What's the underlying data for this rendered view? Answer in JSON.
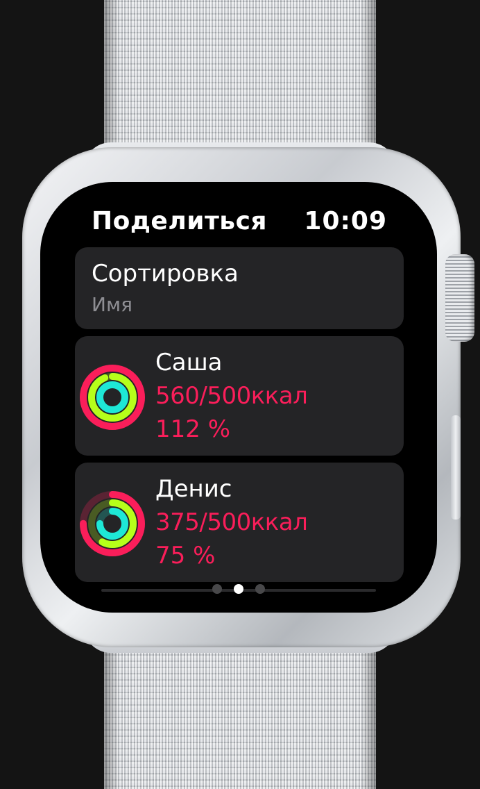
{
  "screen": {
    "title": "Поделиться",
    "time": "10:09"
  },
  "sort": {
    "label": "Сортировка",
    "value": "Имя"
  },
  "friends": [
    {
      "name": "Саша",
      "calories": "560/500ккал",
      "percent": "112 %",
      "move_progress": 1.12,
      "exercise_progress": 0.94,
      "stand_progress": 1.0
    },
    {
      "name": "Денис",
      "calories": "375/500ккал",
      "percent": "75 %",
      "move_progress": 0.75,
      "exercise_progress": 0.58,
      "stand_progress": 0.75
    }
  ],
  "pagination": {
    "total": 3,
    "active_index": 1
  },
  "colors": {
    "move": "#fa1e5a",
    "exercise": "#b6ff1a",
    "stand": "#1ee8d6",
    "accent_text": "#fa1e5a",
    "card": "#242426"
  },
  "icons": [
    "activity-rings-icon"
  ]
}
